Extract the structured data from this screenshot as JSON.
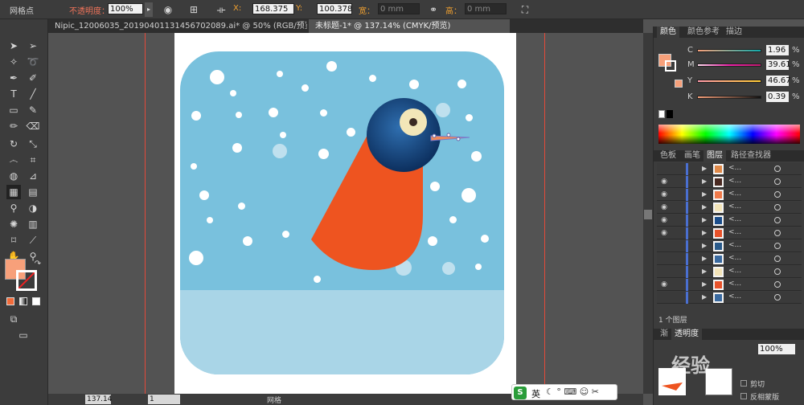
{
  "control_bar": {
    "tool_label": "网格点",
    "opacity_label": "不透明度：",
    "opacity_value": "100%",
    "x_label": "X:",
    "x_value": "168.375",
    "y_label": "Y:",
    "y_value": "100.378",
    "width_label": "宽：",
    "width_value": "0 mm",
    "height_label": "高：",
    "height_value": "0 mm"
  },
  "doc_tabs": [
    {
      "label": "Nipic_12006035_20190401131456702089.ai* @ 50% (RGB/预览)"
    },
    {
      "label": "未标题-1* @ 137.14% (CMYK/预览)"
    }
  ],
  "color_panel": {
    "tabs": [
      "颜色",
      "颜色参考",
      "描边"
    ],
    "channels": [
      {
        "name": "C",
        "value": "1.96"
      },
      {
        "name": "M",
        "value": "39.61"
      },
      {
        "name": "Y",
        "value": "46.67"
      },
      {
        "name": "K",
        "value": "0.39"
      }
    ],
    "fill_color": "#f7a07a",
    "pct": "%"
  },
  "layers_panel": {
    "tabs": [
      "色板",
      "画笔",
      "图层",
      "路径查找器"
    ],
    "rows": [
      {
        "name": "<...",
        "visible": false,
        "thumb": "#e08a4a"
      },
      {
        "name": "<...",
        "visible": true,
        "thumb": "#4a2a22"
      },
      {
        "name": "<...",
        "visible": true,
        "thumb": "#f07a4a"
      },
      {
        "name": "<...",
        "visible": true,
        "thumb": "#f3e4b8"
      },
      {
        "name": "<...",
        "visible": true,
        "thumb": "#1b4d8a"
      },
      {
        "name": "<...",
        "visible": true,
        "thumb": "#e8522a"
      },
      {
        "name": "<...",
        "visible": false,
        "thumb": "#2a5a8a"
      },
      {
        "name": "<...",
        "visible": false,
        "thumb": "#3a6aa0"
      },
      {
        "name": "<...",
        "visible": false,
        "thumb": "#f3e4b8"
      },
      {
        "name": "<...",
        "visible": true,
        "thumb": "#e8522a"
      },
      {
        "name": "<...",
        "visible": false,
        "thumb": "#3a6aa0"
      }
    ],
    "footer": "1 个图层"
  },
  "bottom_panel": {
    "tabs": [
      "渐",
      "透明度"
    ],
    "opacity_value": "100%",
    "checkbox1": "剪切",
    "checkbox2": "反相蒙版"
  },
  "status_bar": {
    "zoom": "137.14",
    "page": "1",
    "tool": "网格"
  },
  "ime": {
    "lang": "英"
  },
  "watermark": "经验"
}
